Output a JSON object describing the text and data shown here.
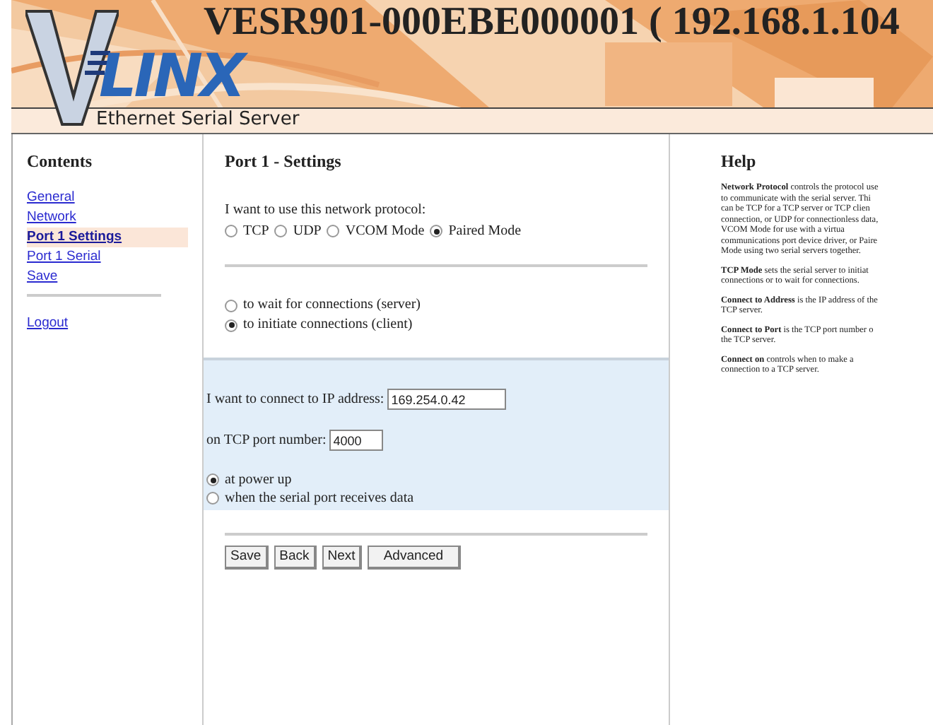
{
  "header": {
    "logo_text": "LINX",
    "title": "VESR901-000EBE000001 ( 192.168.1.104",
    "subtitle": "Ethernet Serial Server"
  },
  "sidebar": {
    "heading": "Contents",
    "items": [
      {
        "label": "General",
        "selected": false
      },
      {
        "label": "Network",
        "selected": false
      },
      {
        "label": "Port 1 Settings",
        "selected": true
      },
      {
        "label": "Port 1 Serial",
        "selected": false
      },
      {
        "label": "Save",
        "selected": false
      }
    ],
    "logout": "Logout"
  },
  "main": {
    "title": "Port 1 - Settings",
    "protocol_prompt": "I want to use this network protocol:",
    "protocols": [
      {
        "label": "TCP",
        "selected": false
      },
      {
        "label": "UDP",
        "selected": false
      },
      {
        "label": "VCOM Mode",
        "selected": false
      },
      {
        "label": "Paired Mode",
        "selected": true
      }
    ],
    "modes": [
      {
        "label": "to wait for connections (server)",
        "selected": false
      },
      {
        "label": "to initiate connections (client)",
        "selected": true
      }
    ],
    "ip_label": "I want to connect to IP address:",
    "ip_value": "169.254.0.42",
    "port_label": "on TCP port number:",
    "port_value": "4000",
    "connect_on": [
      {
        "label": "at power up",
        "selected": true
      },
      {
        "label": "when the serial port receives data",
        "selected": false
      }
    ],
    "buttons": [
      "Save",
      "Back",
      "Next",
      "Advanced"
    ]
  },
  "help": {
    "title": "Help",
    "paragraphs": [
      {
        "lines": [
          "**Network Protocol** controls the protocol use",
          "to communicate with the serial server. Thi",
          "can be TCP for a TCP server or TCP clien",
          "connection, or UDP for connectionless data,",
          "VCOM Mode for use with a virtua",
          "communications port device driver, or Paire",
          "Mode using two serial servers together."
        ]
      },
      {
        "lines": [
          "**TCP Mode** sets the serial server to initiat",
          "connections or to wait for connections."
        ]
      },
      {
        "lines": [
          "**Connect to Address** is the IP address of the",
          "TCP server."
        ]
      },
      {
        "lines": [
          "**Connect to Port** is the TCP port number o",
          "the TCP server."
        ]
      },
      {
        "lines": [
          "**Connect on** controls when to make a",
          "connection to a TCP server."
        ]
      }
    ]
  }
}
